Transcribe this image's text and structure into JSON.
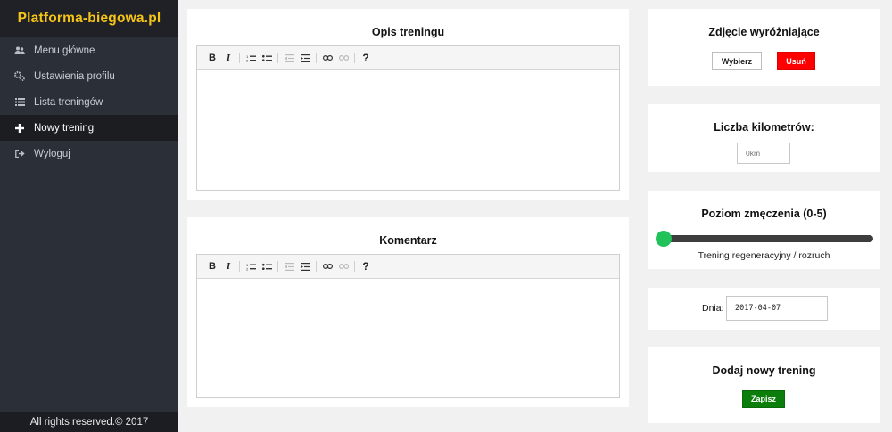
{
  "brand": "Platforma-biegowa.pl",
  "nav": [
    {
      "label": "Menu główne",
      "icon": "users-icon"
    },
    {
      "label": "Ustawienia profilu",
      "icon": "gears-icon"
    },
    {
      "label": "Lista treningów",
      "icon": "list-icon"
    },
    {
      "label": "Nowy trening",
      "icon": "plus-icon",
      "active": true
    },
    {
      "label": "Wyloguj",
      "icon": "logout-icon"
    }
  ],
  "footer": "All rights reserved.© 2017",
  "description": {
    "title": "Opis treningu",
    "body": ""
  },
  "comment": {
    "title": "Komentarz",
    "body": ""
  },
  "toolbar": {
    "bold": "B",
    "italic": "I",
    "help": "?"
  },
  "featured_image": {
    "title": "Zdjęcie wyróżniające",
    "choose_label": "Wybierz",
    "remove_label": "Usuń"
  },
  "kilometers": {
    "title": "Liczba kilometrów:",
    "placeholder": "0km",
    "value": ""
  },
  "fatigue": {
    "title": "Poziom zmęczenia (0-5)",
    "value": 0,
    "min": 0,
    "max": 5,
    "caption": "Trening regeneracyjny / rozruch",
    "thumb_color": "#22c25b",
    "track_color": "#3d3d3d"
  },
  "date": {
    "label": "Dnia:",
    "value": "2017-04-07"
  },
  "add_training": {
    "title": "Dodaj nowy trening",
    "save_label": "Zapisz"
  },
  "colors": {
    "brand": "#f6c417",
    "remove": "#ff0000",
    "save": "#0b7d0b"
  }
}
